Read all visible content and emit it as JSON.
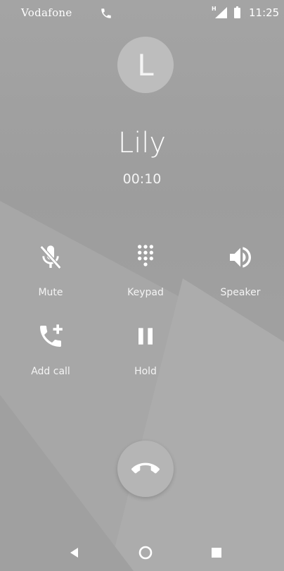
{
  "status_bar": {
    "carrier": "Vodafone",
    "network_type": "H",
    "time": "11:25",
    "icons": [
      "phone-call-status-icon",
      "cell-signal-icon",
      "battery-icon"
    ]
  },
  "call": {
    "avatar_letter": "L",
    "caller_name": "Lily",
    "duration": "00:10"
  },
  "controls": [
    {
      "id": "mute",
      "label": "Mute",
      "icon": "microphone-off-icon"
    },
    {
      "id": "keypad",
      "label": "Keypad",
      "icon": "dialpad-icon"
    },
    {
      "id": "speaker",
      "label": "Speaker",
      "icon": "speaker-icon"
    },
    {
      "id": "add_call",
      "label": "Add call",
      "icon": "add-call-icon"
    },
    {
      "id": "hold",
      "label": "Hold",
      "icon": "pause-icon"
    }
  ],
  "end_call": {
    "icon": "hang-up-icon"
  },
  "nav_bar": {
    "icons": [
      "back-icon",
      "home-icon",
      "recents-icon"
    ]
  },
  "colors": {
    "background": "#a2a2a2",
    "avatar_bg": "#bdbdbd",
    "end_call_bg": "#b5b5b5",
    "foreground": "#ffffff"
  }
}
